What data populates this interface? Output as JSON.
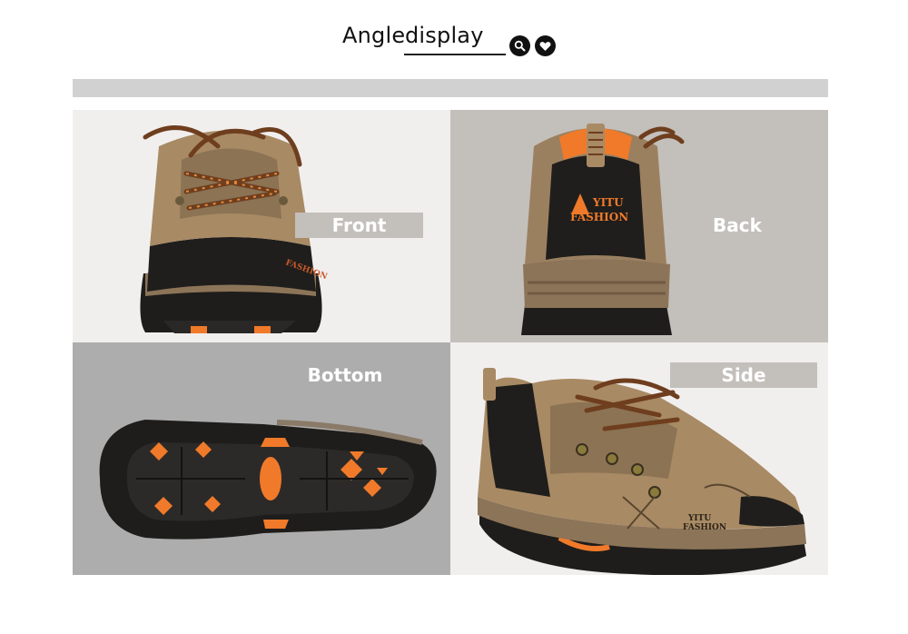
{
  "header": {
    "title_word1": "Angle",
    "title_word2": "display",
    "icons": [
      "search-icon",
      "heart-icon"
    ]
  },
  "views": {
    "front": {
      "label": "Front",
      "brand": "FASHION"
    },
    "back": {
      "label": "Back",
      "brand_line1": "YITU",
      "brand_line2": "FASHION"
    },
    "bottom": {
      "label": "Bottom"
    },
    "side": {
      "label": "Side",
      "brand_line1": "YITU",
      "brand_line2": "FASHION"
    }
  },
  "colors": {
    "leather": "#a88a64",
    "sole_black": "#1e1d1b",
    "sole_orange": "#f07a2a",
    "lace_brown": "#7a4a24"
  }
}
